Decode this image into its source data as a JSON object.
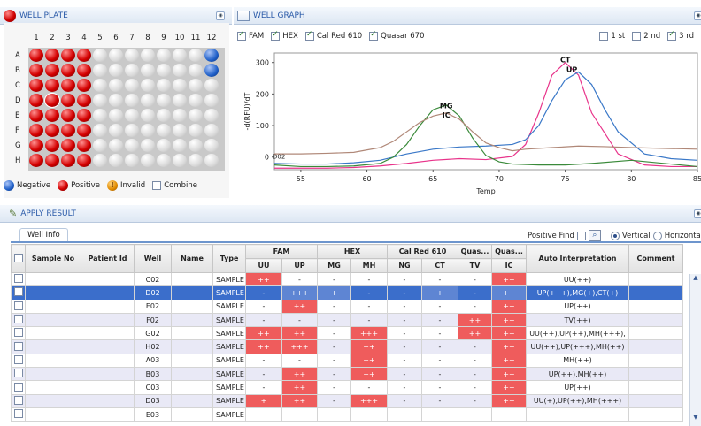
{
  "well_plate": {
    "title": "WELL PLATE",
    "columns": [
      "1",
      "2",
      "3",
      "4",
      "5",
      "6",
      "7",
      "8",
      "9",
      "10",
      "11",
      "12"
    ],
    "rows": [
      "A",
      "B",
      "C",
      "D",
      "E",
      "F",
      "G",
      "H"
    ],
    "positive_cols": [
      1,
      2,
      3,
      4
    ],
    "negative_wells": [
      "A12",
      "B12"
    ],
    "selected_well": "D02",
    "legend": {
      "negative": "Negative",
      "positive": "Positive",
      "invalid": "Invalid",
      "combine": "Combine"
    }
  },
  "well_graph": {
    "title": "WELL GRAPH",
    "dye_filters": [
      {
        "label": "FAM",
        "checked": true
      },
      {
        "label": "HEX",
        "checked": true
      },
      {
        "label": "Cal Red 610",
        "checked": true
      },
      {
        "label": "Quasar 670",
        "checked": true
      }
    ],
    "deriv_options": [
      {
        "label": "1 st",
        "checked": false
      },
      {
        "label": "2 nd",
        "checked": false
      },
      {
        "label": "3 rd",
        "checked": true
      }
    ]
  },
  "chart_data": {
    "type": "line",
    "xlabel": "Temp",
    "ylabel": "-d(RFU)/dT",
    "xlim": [
      53,
      85
    ],
    "ylim": [
      -40,
      330
    ],
    "xticks": [
      55,
      60,
      65,
      70,
      75,
      80,
      85
    ],
    "yticks": [
      0,
      100,
      200,
      300
    ],
    "row_label": "D02",
    "annotations": [
      {
        "text": "MG",
        "x": 66,
        "y": 155
      },
      {
        "text": "IC",
        "x": 66,
        "y": 125
      },
      {
        "text": "CT",
        "x": 75,
        "y": 300
      },
      {
        "text": "UP",
        "x": 75.5,
        "y": 270
      }
    ],
    "series": [
      {
        "color": "#e8338a",
        "x": [
          53,
          55,
          57,
          59,
          61,
          63,
          65,
          67,
          69,
          71,
          72,
          73,
          74,
          75,
          76,
          77,
          79,
          81,
          83,
          85
        ],
        "y": [
          -35,
          -35,
          -35,
          -33,
          -28,
          -20,
          -10,
          -5,
          -8,
          2,
          40,
          140,
          260,
          300,
          260,
          140,
          10,
          -25,
          -30,
          -30
        ]
      },
      {
        "color": "#3a78c8",
        "x": [
          53,
          55,
          57,
          59,
          61,
          63,
          65,
          67,
          69,
          71,
          72,
          73,
          74,
          75,
          76,
          77,
          78,
          79,
          81,
          83,
          85
        ],
        "y": [
          -20,
          -22,
          -22,
          -18,
          -10,
          10,
          25,
          32,
          35,
          40,
          55,
          100,
          180,
          245,
          270,
          230,
          150,
          80,
          10,
          -5,
          -10
        ]
      },
      {
        "color": "#3a8a3a",
        "x": [
          53,
          55,
          57,
          59,
          61,
          62,
          63,
          64,
          65,
          66,
          67,
          68,
          69,
          70,
          71,
          73,
          75,
          77,
          80,
          85
        ],
        "y": [
          -25,
          -30,
          -30,
          -28,
          -20,
          0,
          40,
          100,
          150,
          165,
          130,
          60,
          5,
          -15,
          -22,
          -25,
          -25,
          -20,
          -10,
          -30
        ]
      },
      {
        "color": "#b08878",
        "x": [
          53,
          55,
          57,
          59,
          61,
          62,
          63,
          64,
          65,
          66,
          67,
          68,
          69,
          70,
          71,
          72,
          74,
          76,
          78,
          80,
          85
        ],
        "y": [
          10,
          10,
          12,
          15,
          30,
          50,
          80,
          110,
          130,
          140,
          120,
          80,
          45,
          30,
          20,
          25,
          30,
          35,
          33,
          30,
          25
        ]
      }
    ]
  },
  "apply_result": {
    "title": "APPLY RESULT",
    "tab": "Well Info",
    "positive_find": "Positive Find",
    "view_options": [
      {
        "label": "Vertical",
        "selected": true
      },
      {
        "label": "Horizonta",
        "selected": false
      }
    ],
    "header_groups": [
      "FAM",
      "HEX",
      "Cal Red 610",
      "Quas...",
      "Quas..."
    ],
    "columns": {
      "sample_no": "Sample No",
      "patient_id": "Patient Id",
      "well": "Well",
      "name": "Name",
      "type": "Type",
      "targets": [
        "UU",
        "UP",
        "MG",
        "MH",
        "NG",
        "CT",
        "TV",
        "IC"
      ],
      "interp": "Auto  Interpretation",
      "comment": "Comment"
    },
    "rows": [
      {
        "well": "C02",
        "type": "SAMPLE",
        "v": [
          "++",
          "-",
          "-",
          "-",
          "-",
          "-",
          "-",
          "++"
        ],
        "hl": [
          1,
          0,
          0,
          0,
          0,
          0,
          0,
          1
        ],
        "interp": "UU(++)"
      },
      {
        "well": "D02",
        "type": "SAMPLE",
        "v": [
          "-",
          "+++",
          "+",
          "-",
          "-",
          "+",
          "-",
          "++"
        ],
        "hl": [
          0,
          1,
          1,
          0,
          0,
          1,
          0,
          1
        ],
        "interp": "UP(+++),MG(+),CT(+)",
        "sel": true
      },
      {
        "well": "E02",
        "type": "SAMPLE",
        "v": [
          "-",
          "++",
          "-",
          "-",
          "-",
          "-",
          "-",
          "++"
        ],
        "hl": [
          0,
          1,
          0,
          0,
          0,
          0,
          0,
          1
        ],
        "interp": "UP(++)"
      },
      {
        "well": "F02",
        "type": "SAMPLE",
        "v": [
          "-",
          "-",
          "-",
          "-",
          "-",
          "-",
          "++",
          "++"
        ],
        "hl": [
          0,
          0,
          0,
          0,
          0,
          0,
          1,
          1
        ],
        "interp": "TV(++)"
      },
      {
        "well": "G02",
        "type": "SAMPLE",
        "v": [
          "++",
          "++",
          "-",
          "+++",
          "-",
          "-",
          "++",
          "++"
        ],
        "hl": [
          1,
          1,
          0,
          1,
          0,
          0,
          1,
          1
        ],
        "interp": "UU(++),UP(++),MH(+++),"
      },
      {
        "well": "H02",
        "type": "SAMPLE",
        "v": [
          "++",
          "+++",
          "-",
          "++",
          "-",
          "-",
          "-",
          "++"
        ],
        "hl": [
          1,
          1,
          0,
          1,
          0,
          0,
          0,
          1
        ],
        "interp": "UU(++),UP(+++),MH(++)"
      },
      {
        "well": "A03",
        "type": "SAMPLE",
        "v": [
          "-",
          "-",
          "-",
          "++",
          "-",
          "-",
          "-",
          "++"
        ],
        "hl": [
          0,
          0,
          0,
          1,
          0,
          0,
          0,
          1
        ],
        "interp": "MH(++)"
      },
      {
        "well": "B03",
        "type": "SAMPLE",
        "v": [
          "-",
          "++",
          "-",
          "++",
          "-",
          "-",
          "-",
          "++"
        ],
        "hl": [
          0,
          1,
          0,
          1,
          0,
          0,
          0,
          1
        ],
        "interp": "UP(++),MH(++)"
      },
      {
        "well": "C03",
        "type": "SAMPLE",
        "v": [
          "-",
          "++",
          "-",
          "-",
          "-",
          "-",
          "-",
          "++"
        ],
        "hl": [
          0,
          1,
          0,
          0,
          0,
          0,
          0,
          1
        ],
        "interp": "UP(++)"
      },
      {
        "well": "D03",
        "type": "SAMPLE",
        "v": [
          "+",
          "++",
          "-",
          "+++",
          "-",
          "-",
          "-",
          "++"
        ],
        "hl": [
          1,
          1,
          0,
          1,
          0,
          0,
          0,
          1
        ],
        "interp": "UU(+),UP(++),MH(+++)"
      },
      {
        "well": "E03",
        "type": "SAMPLE",
        "v": [
          "",
          "",
          "",
          "",
          "",
          "",
          "",
          ""
        ],
        "hl": [
          0,
          0,
          0,
          0,
          0,
          0,
          0,
          0
        ],
        "interp": ""
      }
    ]
  }
}
